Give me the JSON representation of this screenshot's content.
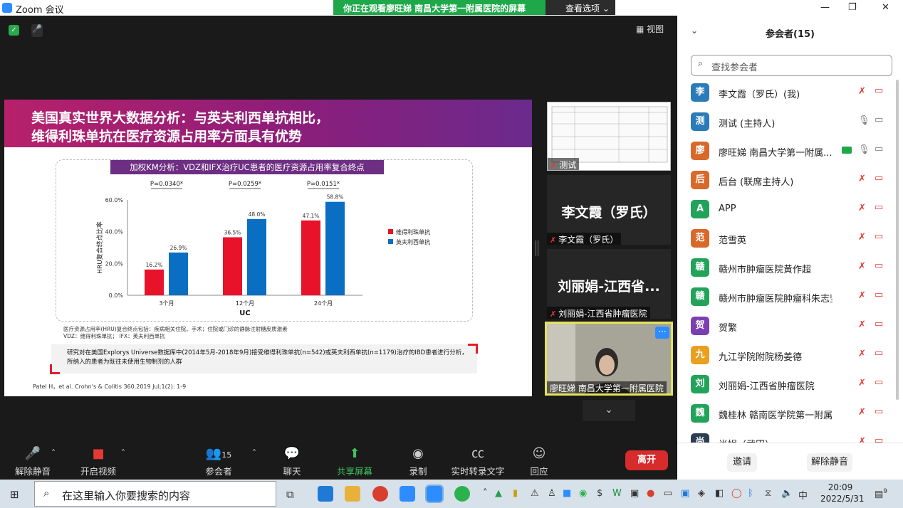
{
  "window": {
    "title": "Zoom 会议"
  },
  "banner": {
    "text": "你正在观看廖旺娣 南昌大学第一附属医院的屏幕",
    "view_options": "查看选项"
  },
  "meeting": {
    "view_label": "视图"
  },
  "slide": {
    "title_line1": "美国真实世界大数据分析：与英夫利西单抗相比，",
    "title_line2": "维得利珠单抗在医疗资源占用率方面具有优势",
    "chart_title": "加权KM分析：VDZ和IFX治疗UC患者的医疗资源占用率复合终点",
    "notes_line1": "医疗资源占用率(HRU)复合终点包括：疾病相关住院、手术；住院或门诊的静脉注射糖皮质激素",
    "notes_line2": "VDZ：维得利珠单抗；  IFX：英夫利西单抗",
    "study_line1": "研究对在美国Explorys Universe数据库中(2014年5月-2018年9月)接受维得利珠单抗(n=542)或英夫利西单抗(n=1179)治疗的IBD患者进行分析，",
    "study_line2": "所纳入的患者为既往未使用生物制剂的人群",
    "citation": "Patel H，et al. Crohn's & Colitis 360.2019 Jul;1(2): 1-9"
  },
  "chart_data": {
    "type": "bar",
    "title": "加权KM分析：VDZ和IFX治疗UC患者的医疗资源占用率复合终点",
    "xlabel": "UC",
    "ylabel": "HRU复合终点比率",
    "categories": [
      "3个月",
      "12个月",
      "24个月"
    ],
    "series": [
      {
        "name": "维得利珠单抗",
        "color": "#e8132a",
        "values": [
          16.2,
          36.5,
          47.1
        ],
        "labels": [
          "16.2%",
          "36.5%",
          "47.1%"
        ]
      },
      {
        "name": "英夫利西单抗",
        "color": "#0a6fc2",
        "values": [
          26.9,
          48.0,
          58.8
        ],
        "labels": [
          "26.9%",
          "48.0%",
          "58.8%"
        ]
      }
    ],
    "pvalues": [
      "P=0.0340*",
      "P=0.0259*",
      "P=0.0151*"
    ],
    "yticks": [
      "0.0%",
      "20.0%",
      "40.0%",
      "60.0%"
    ],
    "ylim": [
      0,
      60
    ],
    "legend_position": "right"
  },
  "thumbnails": [
    {
      "name": "测试"
    },
    {
      "big": "李文霞（罗氏）",
      "name": "李文霞（罗氏）"
    },
    {
      "big": "刘丽娟-江西省...",
      "name": "刘丽娟-江西省肿瘤医院"
    },
    {
      "name": "廖旺娣 南昌大学第一附属医院"
    }
  ],
  "toolbar": {
    "unmute": "解除静音",
    "start_video": "开启视频",
    "participants": "参会者",
    "participants_count": "15",
    "chat": "聊天",
    "share": "共享屏幕",
    "record": "录制",
    "transcript": "实时转录文字",
    "react": "回应",
    "leave": "离开"
  },
  "panel": {
    "title": "参会者(15)",
    "search_placeholder": "查找参会者",
    "participants": [
      {
        "avatar": "李",
        "color": "#2b7bb9",
        "name": "李文霞（罗氏）(我)"
      },
      {
        "avatar": "测",
        "color": "#2b7bb9",
        "name": "测试 (主持人)"
      },
      {
        "avatar": "廖",
        "color": "#d8692a",
        "name": "廖旺娣 南昌大学第一附属..."
      },
      {
        "avatar": "后",
        "color": "#d8692a",
        "name": "后台 (联席主持人)"
      },
      {
        "avatar": "A",
        "color": "#23a35a",
        "name": "APP"
      },
      {
        "avatar": "范",
        "color": "#d8692a",
        "name": "范雪英"
      },
      {
        "avatar": "赣",
        "color": "#23a35a",
        "name": "赣州市肿瘤医院黄作超"
      },
      {
        "avatar": "赣",
        "color": "#23a35a",
        "name": "赣州市肿瘤医院肿瘤科朱志坚"
      },
      {
        "avatar": "贺",
        "color": "#7b3fb0",
        "name": "贺繁"
      },
      {
        "avatar": "九",
        "color": "#e8a020",
        "name": "九江学院附院杨姜德"
      },
      {
        "avatar": "刘",
        "color": "#23a35a",
        "name": "刘丽娟-江西省肿瘤医院"
      },
      {
        "avatar": "魏",
        "color": "#23a35a",
        "name": "魏桂林  赣南医学院第一附属医院"
      },
      {
        "avatar": "尚",
        "color": "#2c3e50",
        "name": "尚娟（武田）"
      }
    ],
    "invite": "邀请",
    "unmute_all": "解除静音"
  },
  "taskbar": {
    "search_placeholder": "在这里输入你要搜索的内容",
    "time": "20:09",
    "date": "2022/5/31",
    "ime": "中",
    "badge": "9"
  }
}
